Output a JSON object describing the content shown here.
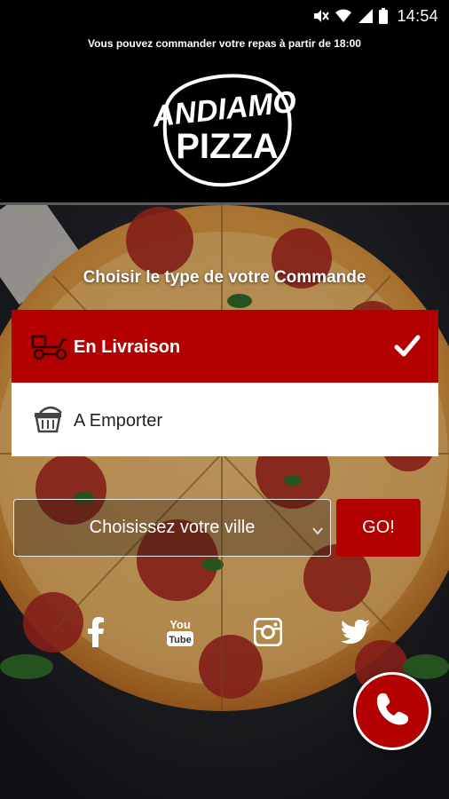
{
  "status_bar": {
    "time": "14:54",
    "icons": [
      "mute-vibrate-icon",
      "wifi-icon",
      "signal-icon",
      "battery-icon"
    ]
  },
  "header": {
    "notice": "Vous pouvez commander votre repas à partir de 18:00",
    "logo": {
      "line1": "ANDIAMO",
      "line2": "PIZZA"
    }
  },
  "order": {
    "title": "Choisir le type de votre Commande",
    "options": [
      {
        "label": "En Livraison",
        "icon": "delivery-scooter-icon",
        "selected": true
      },
      {
        "label": "A Emporter",
        "icon": "basket-icon",
        "selected": false
      }
    ]
  },
  "city": {
    "placeholder": "Choisissez votre ville",
    "go_label": "GO!"
  },
  "social": [
    "facebook-icon",
    "youtube-icon",
    "instagram-icon",
    "twitter-icon"
  ],
  "colors": {
    "accent": "#b30000",
    "background": "#000000",
    "text": "#ffffff"
  }
}
